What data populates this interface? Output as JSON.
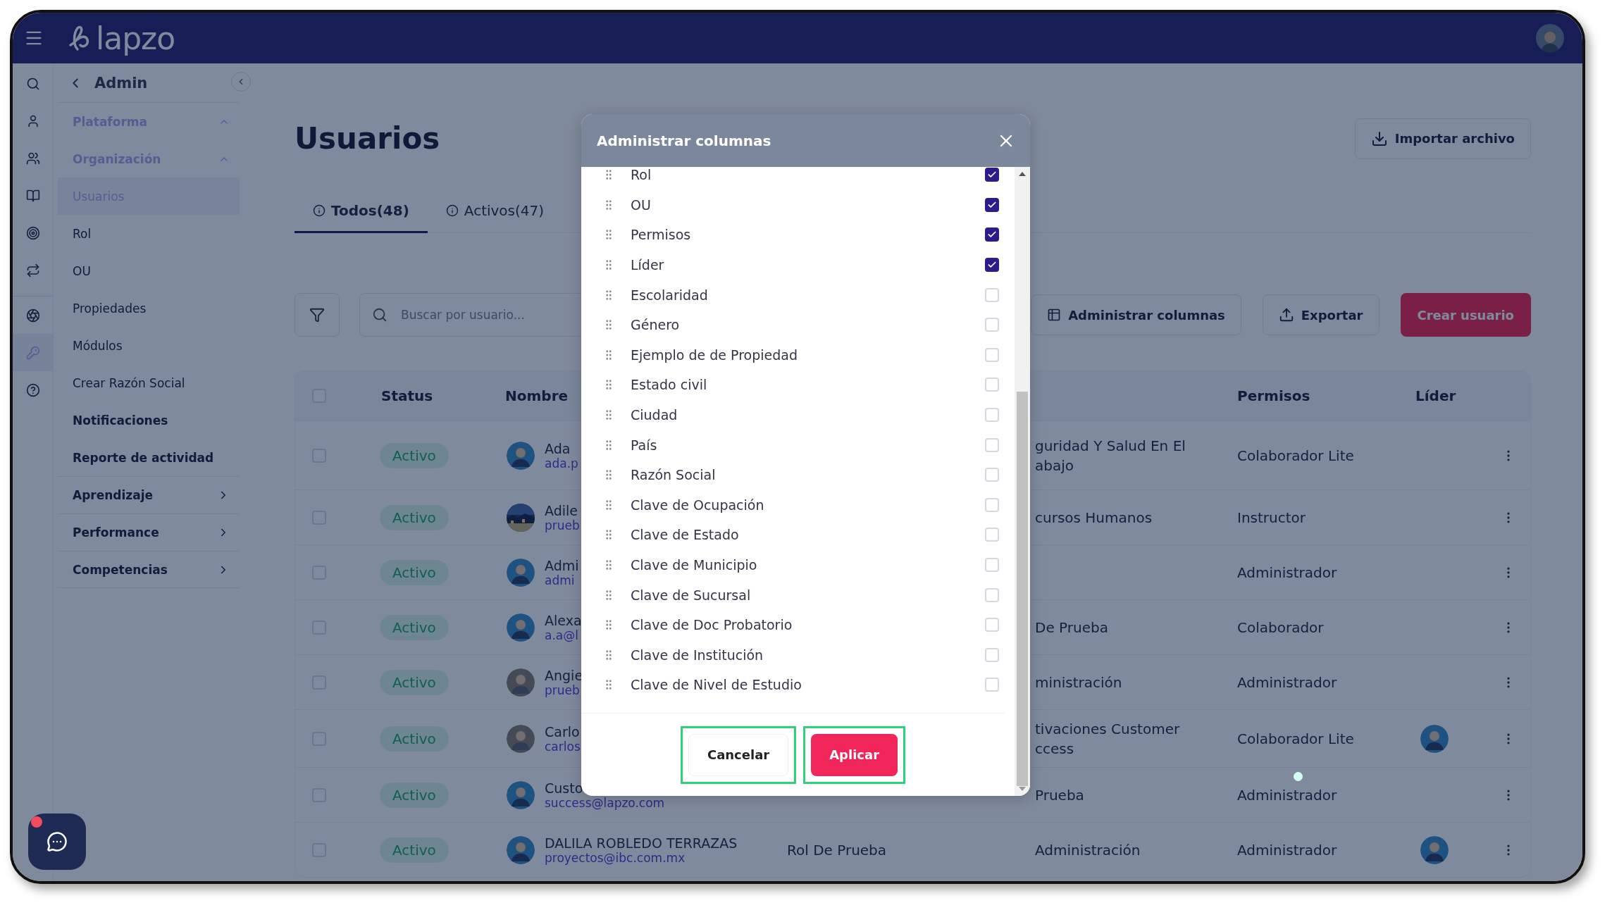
{
  "topbar": {
    "logo": "lapzo"
  },
  "rail": [
    {
      "selected": false
    },
    {
      "selected": false
    },
    {
      "selected": false
    },
    {
      "selected": false
    },
    {
      "selected": false
    },
    {
      "selected": false
    },
    {
      "selected": false
    },
    {
      "selected": true
    },
    {
      "selected": false
    }
  ],
  "sidebar": {
    "title": "Admin",
    "items": [
      {
        "kind": "group",
        "label": "Plataforma",
        "expanded": true
      },
      {
        "kind": "group",
        "label": "Organización",
        "expanded": true
      },
      {
        "kind": "link",
        "label": "Usuarios",
        "selected": true
      },
      {
        "kind": "link",
        "label": "Rol",
        "selected": false
      },
      {
        "kind": "link",
        "label": "OU",
        "selected": false
      },
      {
        "kind": "link",
        "label": "Propiedades",
        "selected": false
      },
      {
        "kind": "link",
        "label": "Módulos",
        "selected": false
      },
      {
        "kind": "link",
        "label": "Crear Razón Social",
        "selected": false
      },
      {
        "kind": "page",
        "label": "Notificaciones"
      },
      {
        "kind": "page",
        "label": "Reporte de actividad"
      },
      {
        "kind": "group",
        "label": "Aprendizaje",
        "expanded": false
      },
      {
        "kind": "group",
        "label": "Performance",
        "expanded": false
      },
      {
        "kind": "group",
        "label": "Competencias",
        "expanded": false
      }
    ]
  },
  "page": {
    "title": "Usuarios",
    "import_button": "Importar archivo"
  },
  "tabs": [
    {
      "label": "Todos(48)",
      "selected": true
    },
    {
      "label": "Activos(47)",
      "selected": false
    }
  ],
  "toolbar": {
    "search": {
      "placeholder": "Buscar por usuario..."
    },
    "buttons": [
      {
        "kind": "columns",
        "label": "Administrar columnas"
      },
      {
        "kind": "export",
        "label": "Exportar"
      },
      {
        "kind": "primary",
        "label": "Crear usuario"
      }
    ]
  },
  "table": {
    "all_selected": false,
    "columns": [
      "Status",
      "Nombre",
      "Permisos",
      "Líder"
    ],
    "rows": [
      {
        "selected": false,
        "status": "Activo",
        "avatar": {
          "kind": "default"
        },
        "name": "Ada",
        "email": "ada.p",
        "ou": "guridad Y Salud En El abajo",
        "permisos": "Colaborador Lite",
        "lider": false
      },
      {
        "selected": false,
        "status": "Activo",
        "name": "Adile",
        "email": "prueb",
        "ou": "cursos Humanos",
        "permisos": "Instructor",
        "lider": false
      },
      {
        "selected": false,
        "status": "Activo",
        "avatar": {
          "kind": "default"
        },
        "name": "Admi",
        "email": "admi",
        "permisos": "Administrador",
        "lider": false
      },
      {
        "selected": false,
        "status": "Activo",
        "avatar": {
          "kind": "default"
        },
        "name": "Alexa",
        "email": "a.a@l",
        "ou": "De Prueba",
        "permisos": "Colaborador",
        "lider": false
      },
      {
        "selected": false,
        "status": "Activo",
        "avatar": {
          "kind": "person"
        },
        "name": "Angie",
        "email": "prueb",
        "ou": "ministración",
        "permisos": "Administrador",
        "lider": false
      },
      {
        "selected": false,
        "status": "Activo",
        "avatar": {
          "kind": "person"
        },
        "name": "Carlo",
        "email": "carlos",
        "ou": "tivaciones Customer ccess",
        "permisos": "Colaborador Lite",
        "lider": true
      },
      {
        "selected": false,
        "status": "Activo",
        "avatar": {
          "kind": "default"
        },
        "name": "Custo",
        "email": "success@lapzo.com",
        "ou": "Prueba",
        "permisos": "Administrador",
        "lider": false
      },
      {
        "selected": false,
        "status": "Activo",
        "avatar": {
          "kind": "default"
        },
        "name": "DALILA ROBLEDO TERRAZAS",
        "email": "proyectos@ibc.com.mx",
        "role": "Rol De Prueba",
        "ou": "Administración",
        "permisos": "Administrador",
        "lider": true
      }
    ]
  },
  "modal": {
    "title": "Administrar columnas",
    "columns": [
      {
        "label": "Rol",
        "checked": true
      },
      {
        "label": "OU",
        "checked": true
      },
      {
        "label": "Permisos",
        "checked": true
      },
      {
        "label": "Líder",
        "checked": true
      },
      {
        "label": "Escolaridad",
        "checked": false
      },
      {
        "label": "Género",
        "checked": false
      },
      {
        "label": "Ejemplo de de Propiedad",
        "checked": false
      },
      {
        "label": "Estado civil",
        "checked": false
      },
      {
        "label": "Ciudad",
        "checked": false
      },
      {
        "label": "País",
        "checked": false
      },
      {
        "label": "Razón Social",
        "checked": false
      },
      {
        "label": "Clave de Ocupación",
        "checked": false
      },
      {
        "label": "Clave de Estado",
        "checked": false
      },
      {
        "label": "Clave de Municipio",
        "checked": false
      },
      {
        "label": "Clave de Sucursal",
        "checked": false
      },
      {
        "label": "Clave de Doc Probatorio",
        "checked": false
      },
      {
        "label": "Clave de Institución",
        "checked": false
      },
      {
        "label": "Clave de Nivel de Estudio",
        "checked": false
      }
    ],
    "buttons": [
      {
        "kind": "secondary",
        "label": "Cancelar",
        "focused": true
      },
      {
        "kind": "primary",
        "label": "Aplicar",
        "focused": true
      }
    ]
  }
}
